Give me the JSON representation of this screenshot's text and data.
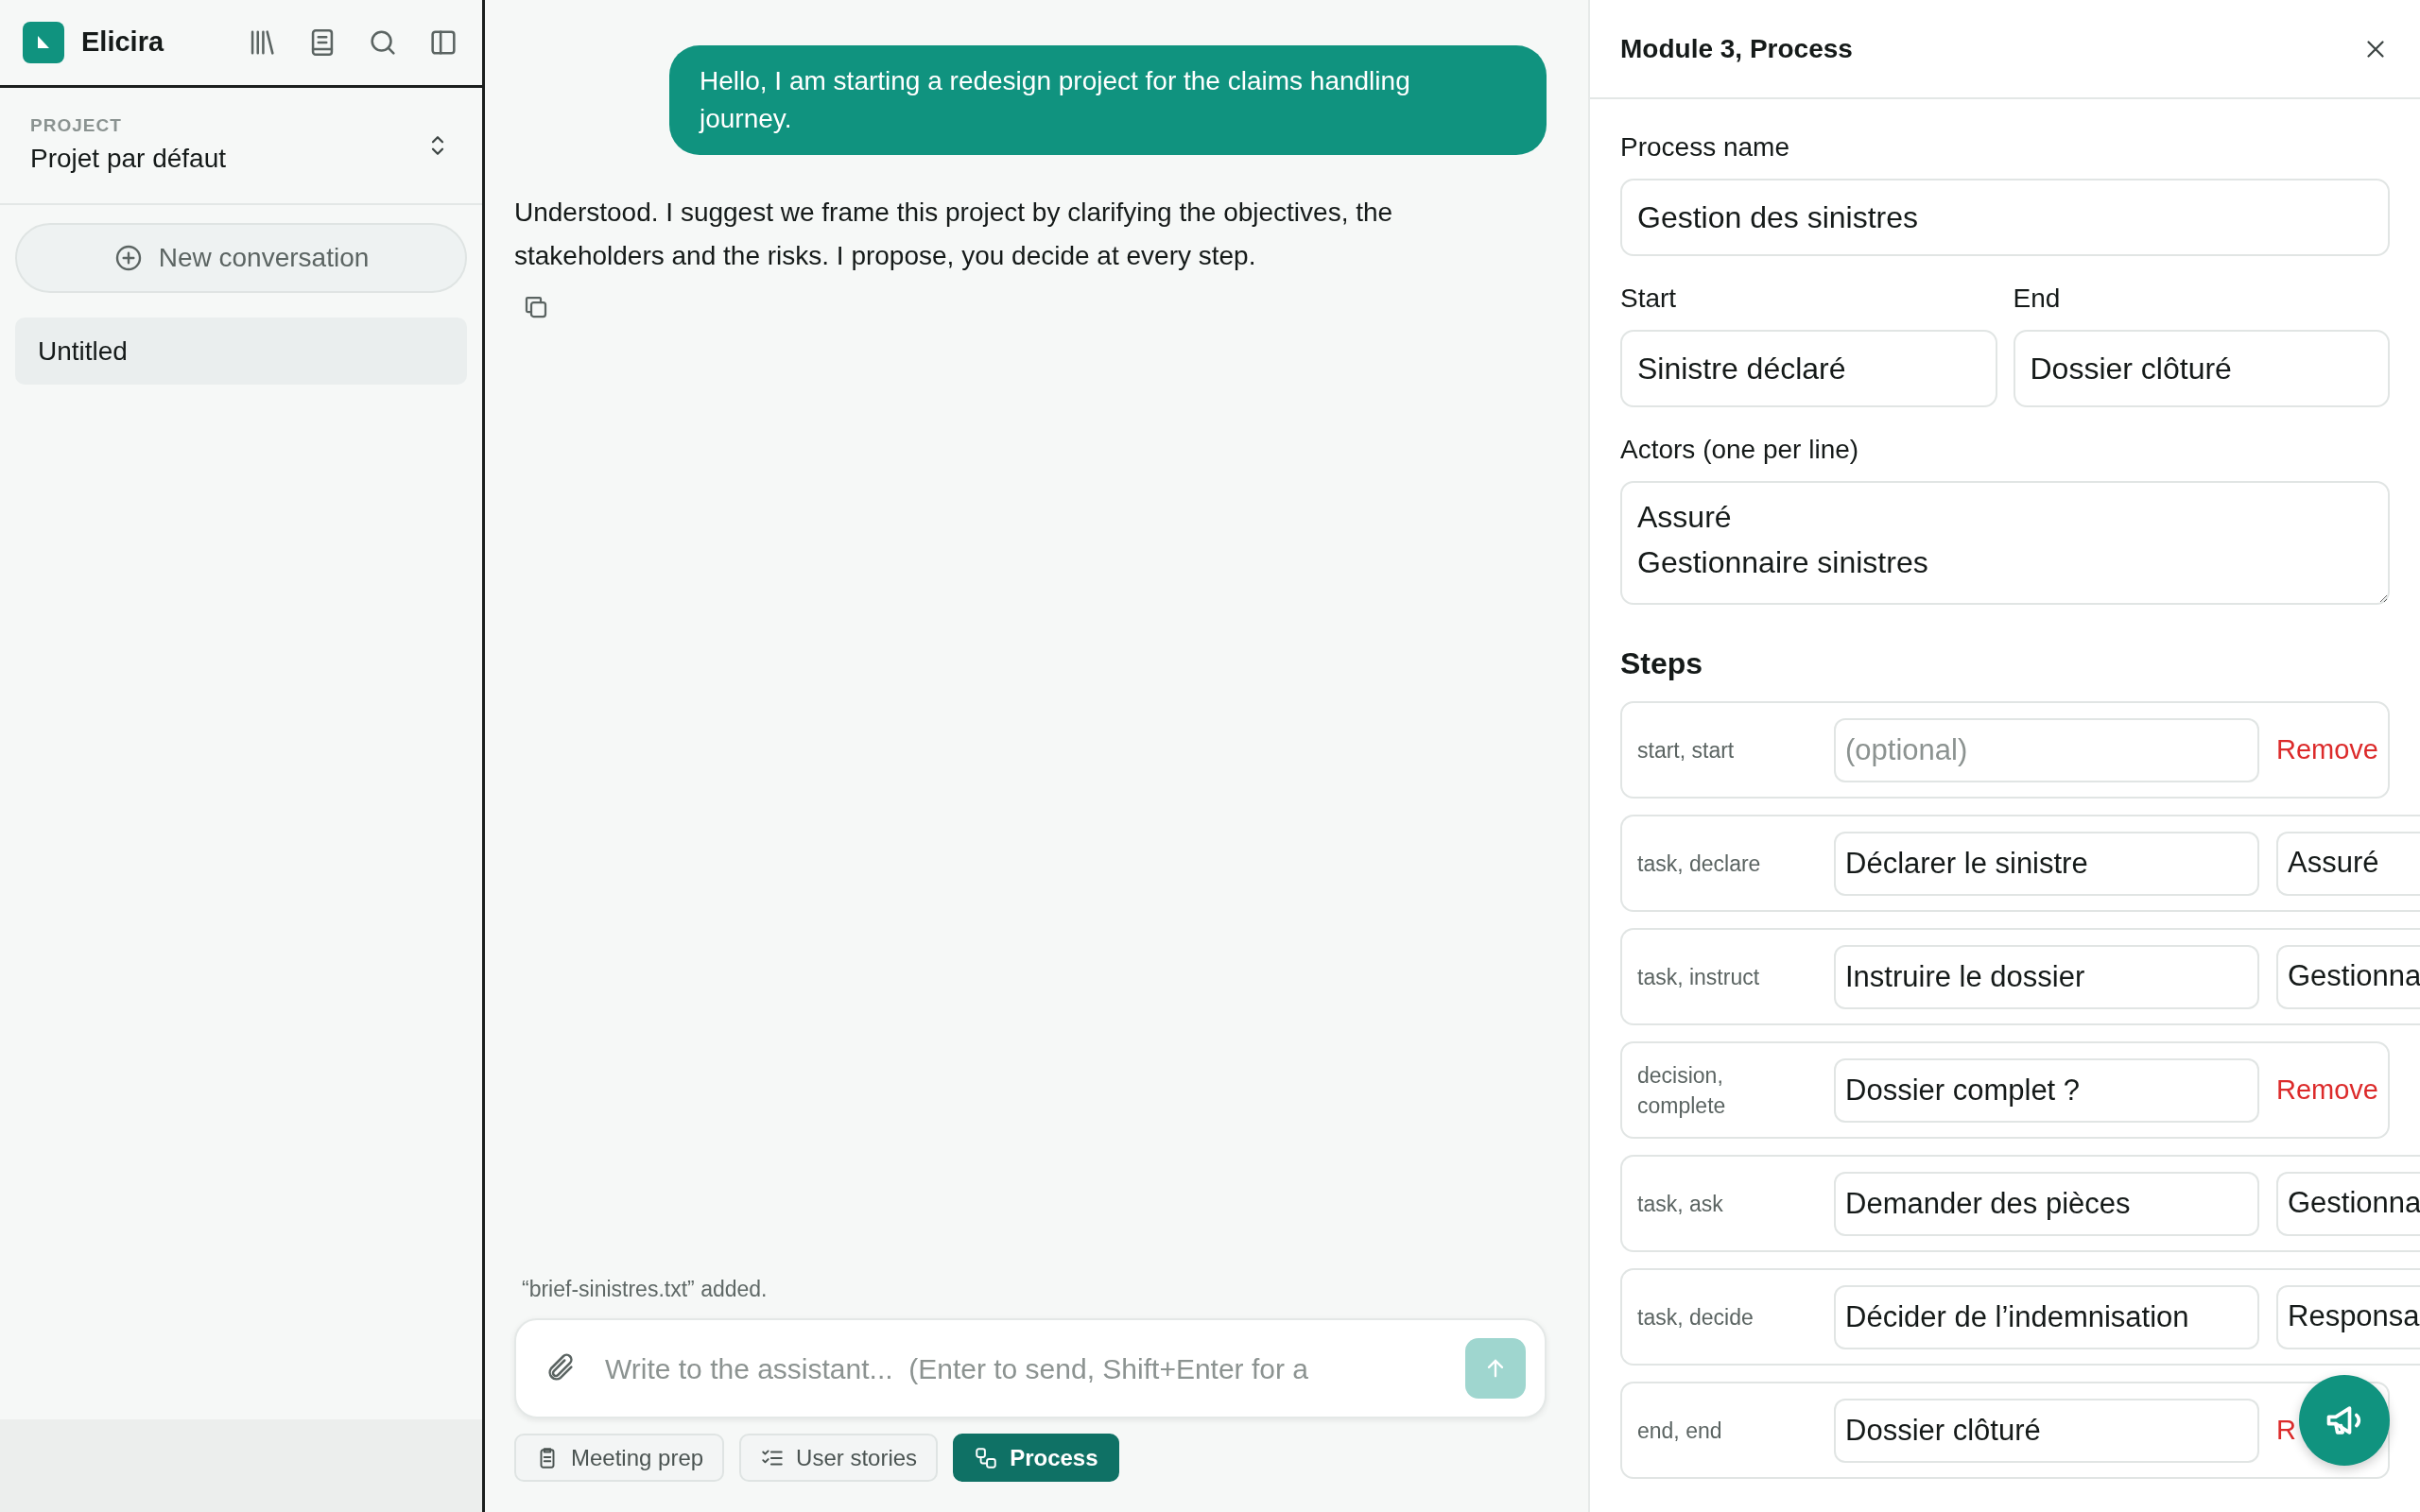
{
  "sidebar": {
    "app_name": "Elicira",
    "project_label": "PROJECT",
    "project_name": "Projet par défaut",
    "new_conversation": "New conversation",
    "conversations": [
      {
        "title": "Untitled",
        "selected": true
      }
    ]
  },
  "chat": {
    "messages": [
      {
        "kind": "user",
        "text": "Hello, I am starting a redesign project for the claims handling journey."
      },
      {
        "kind": "assistant",
        "text": "Understood. I suggest we frame this project by clarifying the objectives, the stakeholders and the risks. I propose, you decide at every step."
      }
    ],
    "attachment_note": "“brief-sinistres.txt” added.",
    "composer": {
      "placeholder": "Write to the assistant...  (Enter to send, Shift+Enter for a",
      "send_disabled": true
    },
    "modes": [
      {
        "label": "Meeting prep",
        "selected": false
      },
      {
        "label": "User stories",
        "selected": false
      },
      {
        "label": "Process",
        "selected": true
      }
    ]
  },
  "panel": {
    "title": "Module 3, Process",
    "process_name": {
      "label": "Process name",
      "value": "Gestion des sinistres"
    },
    "start": {
      "label": "Start",
      "value": "Sinistre déclaré"
    },
    "end": {
      "label": "End",
      "value": "Dossier clôturé"
    },
    "actors": {
      "label": "Actors (one per line)",
      "value": "Assuré\nGestionnaire sinistres"
    },
    "steps_heading": "Steps",
    "steps": [
      {
        "type_label": "start, start",
        "placeholder": "(optional)",
        "remove": "Remove"
      },
      {
        "type_label": "task, declare",
        "name": "Déclarer le sinistre",
        "actor": "Assuré"
      },
      {
        "type_label": "task, instruct",
        "name": "Instruire le dossier",
        "actor": "Gestionna"
      },
      {
        "type_label": "decision, complete",
        "name": "Dossier complet ?",
        "remove": "Remove"
      },
      {
        "type_label": "task, ask",
        "name": "Demander des pièces",
        "actor": "Gestionna"
      },
      {
        "type_label": "task, decide",
        "name": "Décider de l’indemnisation",
        "actor": "Responsa"
      },
      {
        "type_label": "end, end",
        "name": "Dossier clôturé",
        "remove": "R"
      }
    ]
  }
}
